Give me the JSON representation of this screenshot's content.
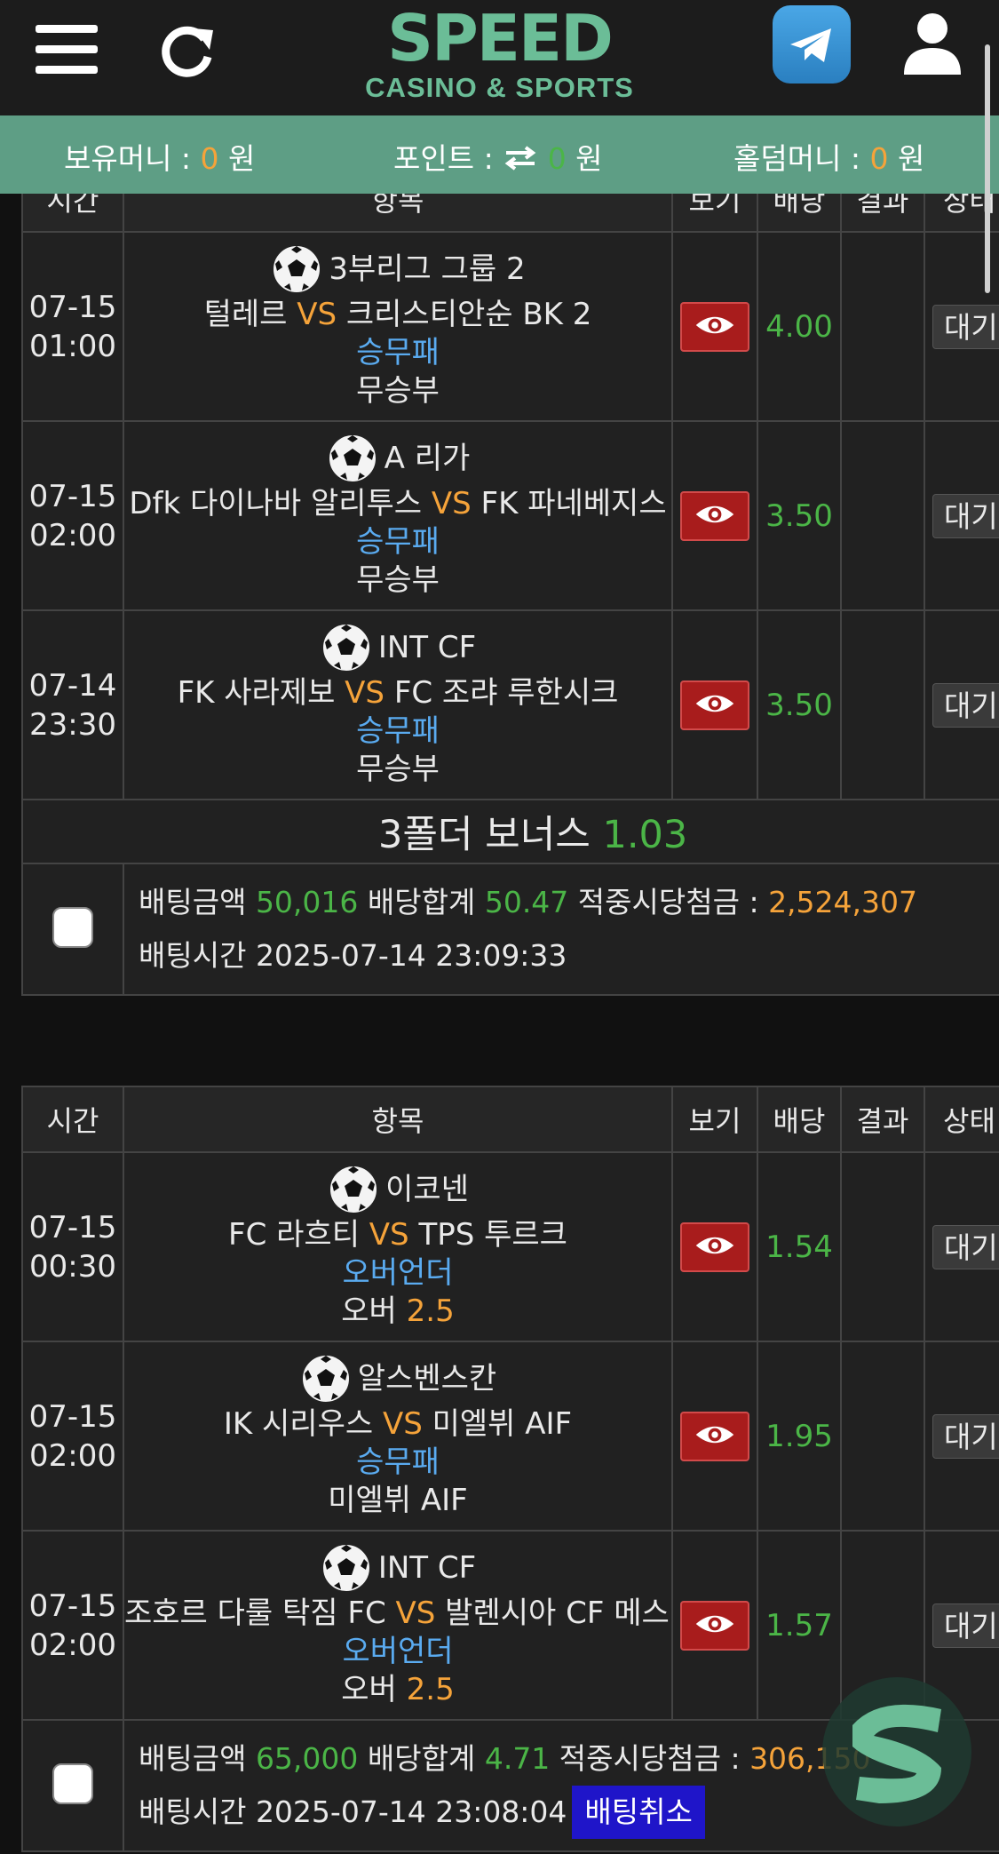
{
  "header": {
    "logo_main": "SPEED",
    "logo_sub": "CASINO & SPORTS"
  },
  "balance": {
    "money_label": "보유머니 : ",
    "money_value": "0",
    "money_unit": " 원",
    "point_label": "포인트 : ",
    "point_value": "0",
    "point_unit": " 원",
    "holdem_label": "홀덤머니 : ",
    "holdem_value": "0",
    "holdem_unit": " 원"
  },
  "columns": [
    "시간",
    "항목",
    "보기",
    "배당",
    "결과",
    "상태"
  ],
  "slips": [
    {
      "matches": [
        {
          "date": "07-15",
          "time": "01:00",
          "league": "3부리그 그룹 2",
          "home": "털레르",
          "vs": "VS",
          "away": "크리스티안순 BK 2",
          "market": "승무패",
          "pick": "무승부",
          "pick_value": "",
          "odds": "4.00",
          "result": "",
          "status": "대기"
        },
        {
          "date": "07-15",
          "time": "02:00",
          "league": "A 리가",
          "home": "Dfk 다이나바 알리투스",
          "vs": "VS",
          "away": "FK 파네베지스",
          "market": "승무패",
          "pick": "무승부",
          "pick_value": "",
          "odds": "3.50",
          "result": "",
          "status": "대기"
        },
        {
          "date": "07-14",
          "time": "23:30",
          "league": "INT CF",
          "home": "FK 사라제보",
          "vs": "VS",
          "away": "FC 조랴 루한시크",
          "market": "승무패",
          "pick": "무승부",
          "pick_value": "",
          "odds": "3.50",
          "result": "",
          "status": "대기"
        }
      ],
      "bonus_label": "3폴더 보너스 ",
      "bonus_value": "1.03",
      "amount_label": "배팅금액 ",
      "amount": "50,016",
      "odds_total_label": " 배당합계 ",
      "odds_total": "50.47",
      "payout_label": " 적중시당첨금 : ",
      "payout": "2,524,307",
      "time_label": "배팅시간 ",
      "bet_time": "2025-07-14 23:09:33"
    },
    {
      "matches": [
        {
          "date": "07-15",
          "time": "00:30",
          "league": "이코넨",
          "home": "FC 라흐티",
          "vs": "VS",
          "away": "TPS 투르크",
          "market": "오버언더",
          "pick": "오버 ",
          "pick_value": "2.5",
          "odds": "1.54",
          "result": "",
          "status": "대기"
        },
        {
          "date": "07-15",
          "time": "02:00",
          "league": "알스벤스칸",
          "home": "IK 시리우스",
          "vs": "VS",
          "away": "미엘뷔 AIF",
          "market": "승무패",
          "pick": "미엘뷔 AIF",
          "pick_value": "",
          "odds": "1.95",
          "result": "",
          "status": "대기"
        },
        {
          "date": "07-15",
          "time": "02:00",
          "league": "INT CF",
          "home": "조호르 다룰 탁짐 FC",
          "vs": "VS",
          "away": "발렌시아 CF 메스타야",
          "market": "오버언더",
          "pick": "오버 ",
          "pick_value": "2.5",
          "odds": "1.57",
          "result": "",
          "status": "대기"
        }
      ],
      "amount_label": "배팅금액 ",
      "amount": "65,000",
      "odds_total_label": " 배당합계 ",
      "odds_total": "4.71",
      "payout_label": " 적중시당첨금 : ",
      "payout": "306,150",
      "time_label": "배팅시간 ",
      "bet_time": "2025-07-14 23:08:04",
      "cancel_label": "배팅취소"
    }
  ],
  "colors": {
    "accent_green": "#5e9e85",
    "odds_green": "#4bb547",
    "highlight_orange": "#f5a33a",
    "market_blue": "#5aabf0",
    "view_button_red": "#a81c1c",
    "cancel_button_blue": "#1f15c9"
  },
  "icons": [
    "menu-icon",
    "refresh-icon",
    "telegram-icon",
    "user-icon",
    "soccer-ball-icon",
    "eye-icon",
    "transfer-icon"
  ]
}
